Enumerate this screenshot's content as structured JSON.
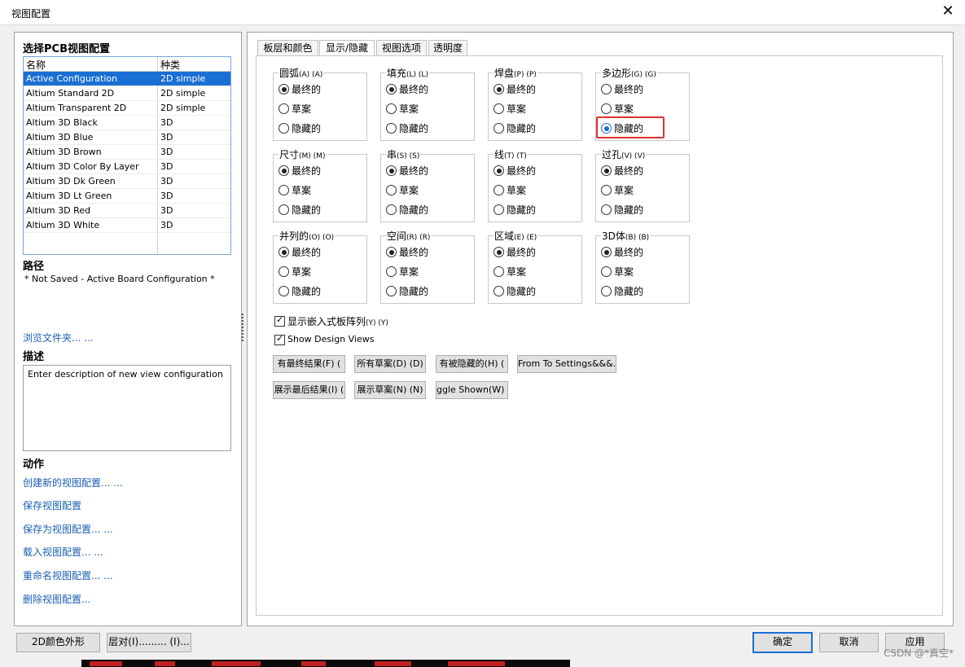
{
  "window": {
    "title": "视图配置",
    "close_glyph": "✕"
  },
  "left": {
    "select_heading": "选择PCB视图配置",
    "list": {
      "col_name": "名称",
      "col_type": "种类",
      "rows": [
        {
          "name": "Active Configuration",
          "type": "2D simple",
          "selected": true
        },
        {
          "name": "Altium Standard 2D",
          "type": "2D simple"
        },
        {
          "name": "Altium Transparent 2D",
          "type": "2D simple"
        },
        {
          "name": "Altium 3D Black",
          "type": "3D"
        },
        {
          "name": "Altium 3D Blue",
          "type": "3D"
        },
        {
          "name": "Altium 3D Brown",
          "type": "3D"
        },
        {
          "name": "Altium 3D Color By Layer",
          "type": "3D"
        },
        {
          "name": "Altium 3D Dk Green",
          "type": "3D"
        },
        {
          "name": "Altium 3D Lt Green",
          "type": "3D"
        },
        {
          "name": "Altium 3D Red",
          "type": "3D"
        },
        {
          "name": "Altium 3D White",
          "type": "3D"
        }
      ]
    },
    "path_heading": "路径",
    "path_value": "* Not Saved - Active Board Configuration *",
    "browse_link": "浏览文件夹... ...",
    "desc_heading": "描述",
    "desc_value": "Enter description of new view configuration",
    "actions_heading": "动作",
    "actions": [
      "创建新的视图配置... ...",
      "保存视图配置",
      "保存为视图配置... ...",
      "载入视图配置... ...",
      "重命名视图配置... ...",
      "删除视图配置..."
    ]
  },
  "tabs": [
    {
      "label": "板层和颜色"
    },
    {
      "label": "显示/隐藏",
      "active": true
    },
    {
      "label": "视图选项"
    },
    {
      "label": "透明度"
    }
  ],
  "option_labels": [
    "最终的",
    "草案",
    "隐藏的"
  ],
  "groups": [
    {
      "title": "圆弧",
      "key": "(A) (A)",
      "selected": 0
    },
    {
      "title": "填充",
      "key": "(L) (L)",
      "selected": 0
    },
    {
      "title": "焊盘",
      "key": "(P) (P)",
      "selected": 0
    },
    {
      "title": "多边形",
      "key": "(G) (G)",
      "selected": 2
    },
    {
      "title": "尺寸",
      "key": "(M) (M)",
      "selected": 0
    },
    {
      "title": "串",
      "key": "(S) (S)",
      "selected": 0
    },
    {
      "title": "线",
      "key": "(T) (T)",
      "selected": 0
    },
    {
      "title": "过孔",
      "key": "(V) (V)",
      "selected": 0
    },
    {
      "title": "并列的",
      "key": "(O) (O)",
      "selected": 0
    },
    {
      "title": "空间",
      "key": "(R) (R)",
      "selected": 0
    },
    {
      "title": "区域",
      "key": "(E) (E)",
      "selected": 0
    },
    {
      "title": "3D体",
      "key": "(B) (B)",
      "selected": 0
    }
  ],
  "checkboxes": [
    {
      "label": "显示嵌入式板阵列",
      "key": "(Y) (Y)",
      "checked": true
    },
    {
      "label": "Show Design Views",
      "key": "",
      "checked": true
    }
  ],
  "buttons_row1": [
    "有最终结果(F) (",
    "所有草案(D) (D)",
    "有被隐藏的(H) (",
    "From To Settings&&&..."
  ],
  "buttons_row2": [
    "展示最后结果(I) (",
    "展示草案(N) (N)",
    "ggle Shown(W) ("
  ],
  "bottom": {
    "btn_2d": "2D颜色外形",
    "btn_layer": "层对(I)......... (I)...",
    "ok": "确定",
    "cancel": "取消",
    "apply": "应用"
  },
  "watermark": "CSDN @*真空*",
  "colors": {
    "accent": "#1a6fd4",
    "link": "#1a5fb4",
    "highlight": "#e03030"
  }
}
